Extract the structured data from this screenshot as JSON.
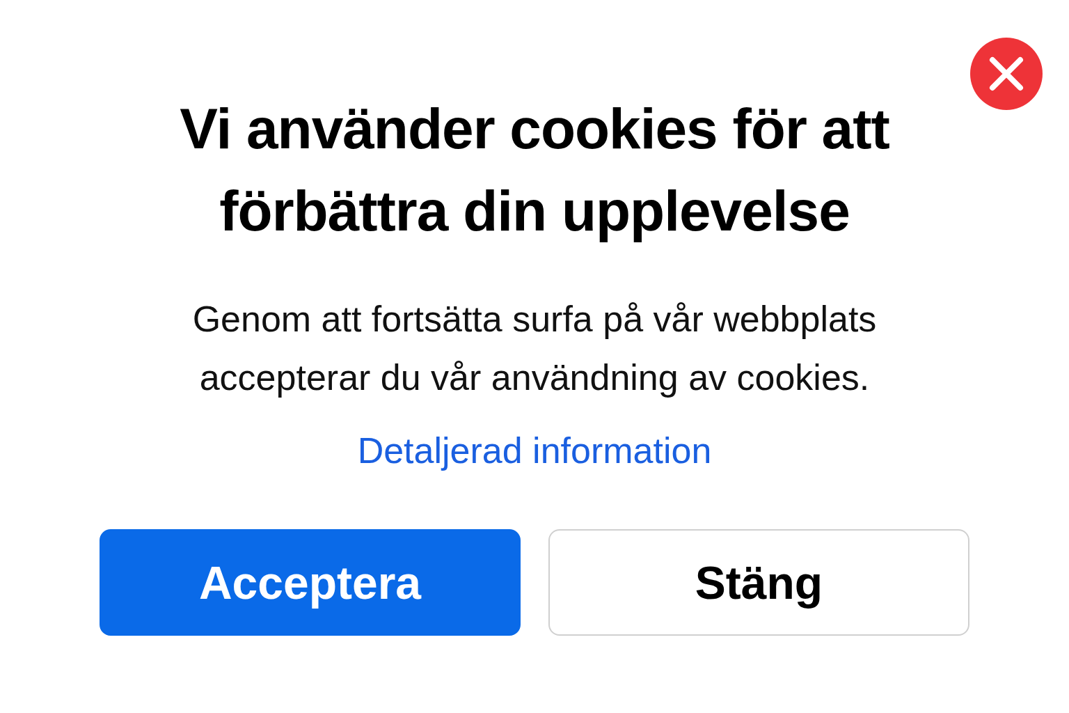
{
  "dialog": {
    "title": "Vi använder cookies för att förbättra din upplevelse",
    "message": "Genom att fortsätta surfa på vår webbplats accepterar du vår användning av cookies.",
    "link": "Detaljerad information",
    "buttons": [
      {
        "label": "Acceptera",
        "kind": "primary"
      },
      {
        "label": "Stäng",
        "kind": "secondary"
      }
    ]
  }
}
